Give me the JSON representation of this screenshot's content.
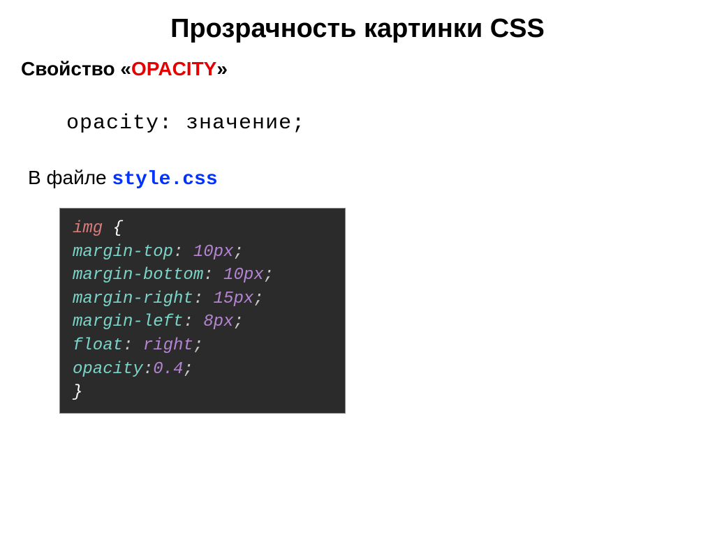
{
  "title": "Прозрачность картинки CSS",
  "subtitle_prefix": "Свойство «",
  "subtitle_highlight": "OPACITY",
  "subtitle_suffix": "»",
  "syntax_property": "opacity:",
  "syntax_value": "значение;",
  "file_ref_prefix": "В файле ",
  "file_ref_filename": "style.css",
  "code": {
    "selector": "img",
    "open_brace": " {",
    "close_brace": "}",
    "lines": [
      {
        "prop": "margin-top",
        "val": "10px"
      },
      {
        "prop": "margin-bottom",
        "val": "10px"
      },
      {
        "prop": "margin-right",
        "val": "15px"
      },
      {
        "prop": "margin-left",
        "val": "8px"
      },
      {
        "prop": "float",
        "val": "right"
      },
      {
        "prop": "opacity",
        "val": "0.4"
      }
    ]
  }
}
